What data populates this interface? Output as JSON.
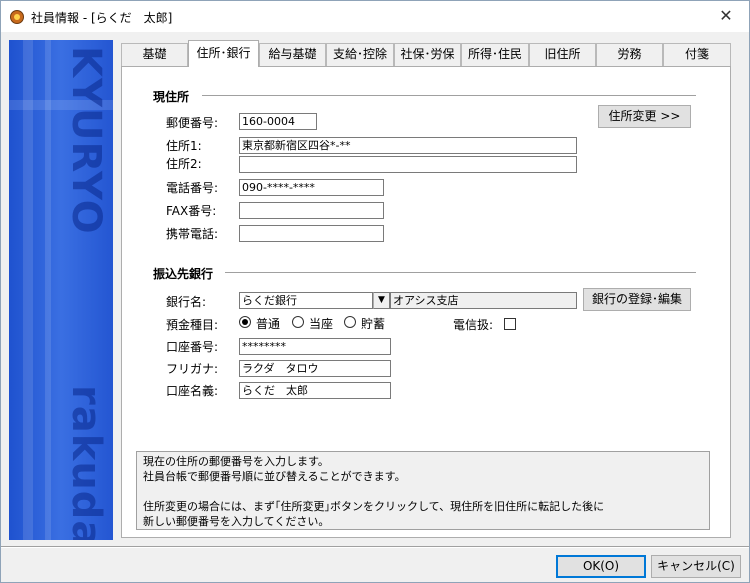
{
  "window": {
    "title": "社員情報 - [らくだ　太郎]",
    "close_glyph": "✕"
  },
  "banner": {
    "top_text": "KYURYO",
    "bottom_text": "rakuda"
  },
  "tabs": [
    {
      "label": "基礎"
    },
    {
      "label": "住所･銀行"
    },
    {
      "label": "給与基礎"
    },
    {
      "label": "支給･控除"
    },
    {
      "label": "社保･労保"
    },
    {
      "label": "所得･住民"
    },
    {
      "label": "旧住所"
    },
    {
      "label": "労務"
    },
    {
      "label": "付箋"
    }
  ],
  "active_tab": "住所･銀行",
  "address": {
    "section_title": "現住所",
    "postal_label": "郵便番号:",
    "postal_value": "160-0004",
    "address1_label": "住所1:",
    "address1_value": "東京都新宿区四谷*-**",
    "address2_label": "住所2:",
    "address2_value": "",
    "phone_label": "電話番号:",
    "phone_value": "090-****-****",
    "fax_label": "FAX番号:",
    "fax_value": "",
    "mobile_label": "携帯電話:",
    "mobile_value": "",
    "change_button": "住所変更 >>"
  },
  "bank": {
    "section_title": "振込先銀行",
    "bank_label": "銀行名:",
    "bank_value": "らくだ銀行",
    "branch_value": "オアシス支店",
    "register_button": "銀行の登録･編集",
    "deposit_label": "預金種目:",
    "deposit_options": [
      "普通",
      "当座",
      "貯蓄"
    ],
    "deposit_selected": "普通",
    "telegraph_label": "電信扱:",
    "account_label": "口座番号:",
    "account_value": "********",
    "kana_label": "フリガナ:",
    "kana_value": "ラクダ　タロウ",
    "holder_label": "口座名義:",
    "holder_value": "らくだ　太郎"
  },
  "help": {
    "lines": [
      "現在の住所の郵便番号を入力します。",
      "社員台帳で郵便番号順に並び替えることができます。",
      "",
      "住所変更の場合には、まず｢住所変更｣ボタンをクリックして、現住所を旧住所に転記した後に",
      "新しい郵便番号を入力してください。"
    ]
  },
  "footer": {
    "ok_button": "OK(O)",
    "cancel_button": "キャンセル(C)"
  }
}
